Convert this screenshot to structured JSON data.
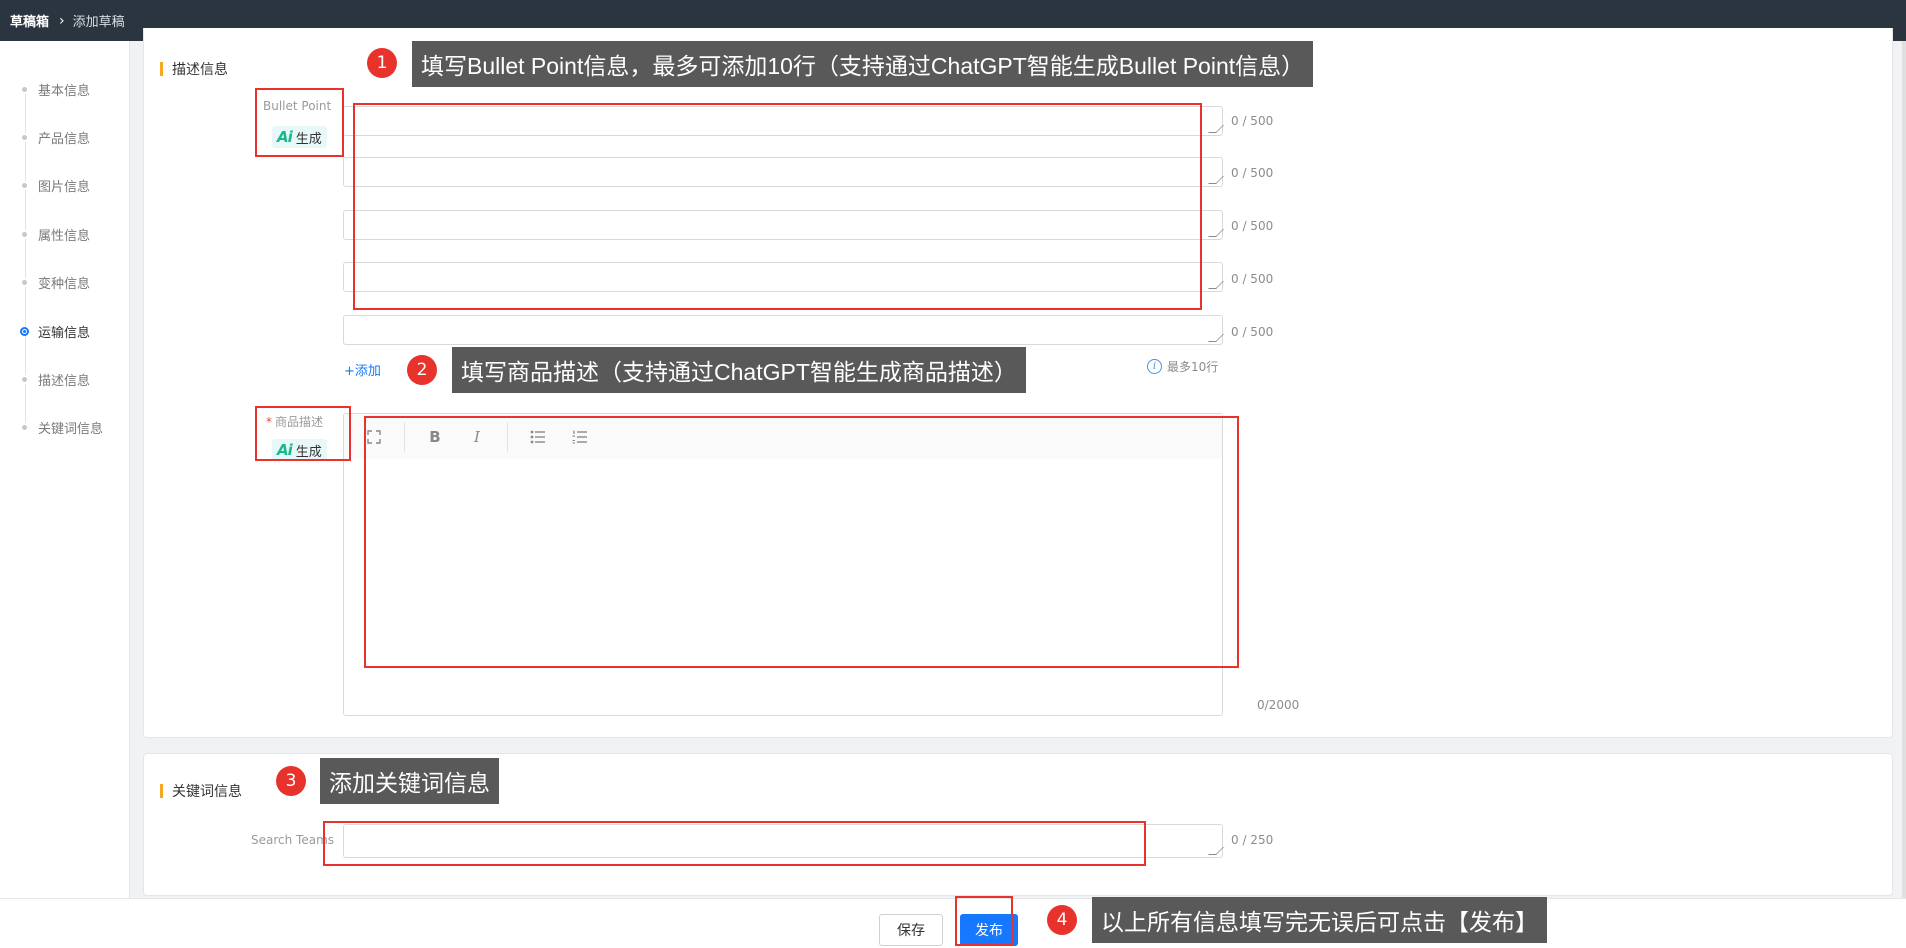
{
  "breadcrumb": {
    "home": "草稿箱",
    "current": "添加草稿"
  },
  "sidebar": {
    "items": [
      {
        "label": "基本信息",
        "active": false
      },
      {
        "label": "产品信息",
        "active": false
      },
      {
        "label": "图片信息",
        "active": false
      },
      {
        "label": "属性信息",
        "active": false
      },
      {
        "label": "变种信息",
        "active": false
      },
      {
        "label": "运输信息",
        "active": true
      },
      {
        "label": "描述信息",
        "active": false
      },
      {
        "label": "关键词信息",
        "active": false
      }
    ]
  },
  "description_section": {
    "title": "描述信息",
    "bullet_label": "Bullet Point",
    "generate_label": "生成",
    "ai_icon": "Ai",
    "bullet_counters": [
      "0 / 500",
      "0 / 500",
      "0 / 500",
      "0 / 500",
      "0 / 500"
    ],
    "add_label": "+添加",
    "limit_note": "最多10行",
    "desc_label": "商品描述",
    "desc_required": "*",
    "editor_counter": "0/2000",
    "toolbar": {
      "fullscreen_icon": "fullscreen-icon",
      "bold": "B",
      "italic": "I",
      "bullet_list_icon": "bullet-list-icon",
      "ordered_list_icon": "ordered-list-icon"
    }
  },
  "keyword_section": {
    "title": "关键词信息",
    "search_terms_label": "Search Teams",
    "counter": "0 / 250"
  },
  "footer": {
    "save_label": "保存",
    "publish_label": "发布"
  },
  "annotations": [
    {
      "num": "1",
      "text": "填写Bullet Point信息，最多可添加10行（支持通过ChatGPT智能生成Bullet Point信息）"
    },
    {
      "num": "2",
      "text": "填写商品描述（支持通过ChatGPT智能生成商品描述）"
    },
    {
      "num": "3",
      "text": "添加关键词信息"
    },
    {
      "num": "4",
      "text": "以上所有信息填写完无误后可点击【发布】"
    }
  ],
  "colors": {
    "topbar": "#2b3540",
    "accent": "#1677ff",
    "annotation_red": "#e8322c",
    "section_bar": "#f5a623"
  }
}
